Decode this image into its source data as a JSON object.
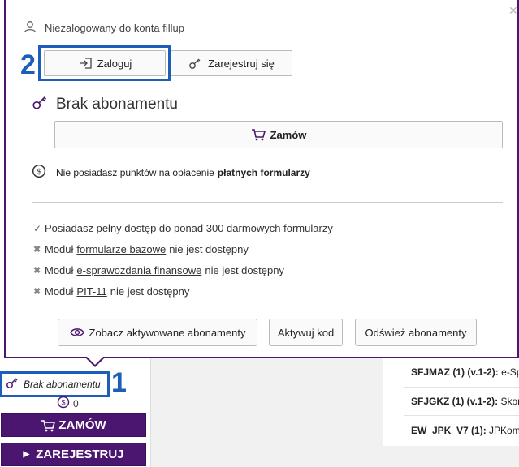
{
  "background": {
    "status_label": "Brak abonamentu",
    "marker_1": "1",
    "points_value": "0",
    "order_label": "ZAMÓW",
    "register_label": "ZAREJESTRUJ",
    "rows": [
      {
        "code": "SFJMAZ (1) (v.1-2):",
        "desc": "e-Sp"
      },
      {
        "code": "SFJGKZ (1) (v.1-2):",
        "desc": "Skon"
      },
      {
        "code": "EW_JPK_V7 (1):",
        "desc": "JPKom"
      }
    ]
  },
  "popup": {
    "close": "✕",
    "user_text": "Niezalogowany do konta fillup",
    "marker_2": "2",
    "login_label": "Zaloguj",
    "register_label": "Zarejestruj się",
    "subscription_title": "Brak abonamentu",
    "order_label": "Zamów",
    "points_text": "Nie posiadasz punktów na opłacenie",
    "points_bold": "płatnych formularzy",
    "features": [
      {
        "pre": "Posiadasz pełny dostęp do ponad 300 darmowych formularzy",
        "link": "",
        "post": ""
      },
      {
        "pre": "Moduł",
        "link": "formularze bazowe",
        "post": "nie jest dostępny"
      },
      {
        "pre": "Moduł",
        "link": "e-sprawozdania finansowe",
        "post": "nie jest dostępny"
      },
      {
        "pre": "Moduł",
        "link": "PIT-11",
        "post": "nie jest dostępny"
      }
    ],
    "see_label": "Zobacz aktywowane abonamenty",
    "activate_label": "Aktywuj kod",
    "refresh_label": "Odśwież abonamenty"
  },
  "colors": {
    "accent": "#4a1670",
    "highlight": "#1d5fb8"
  }
}
